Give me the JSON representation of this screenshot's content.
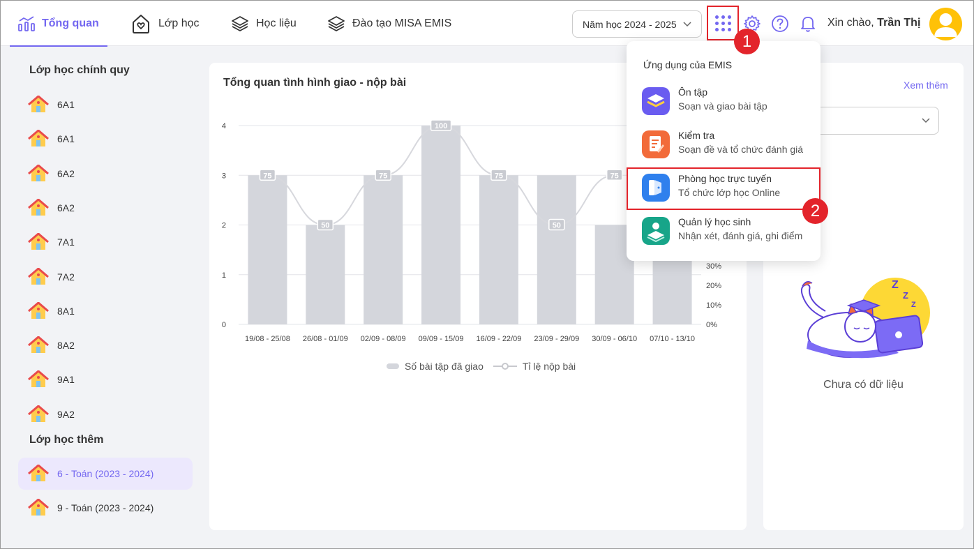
{
  "nav": {
    "overview": "Tổng quan",
    "classes": "Lớp học",
    "materials": "Học liệu",
    "training": "Đào tạo MISA EMIS"
  },
  "header": {
    "year": "Năm học 2024 - 2025",
    "greeting": "Xin chào,",
    "user": "Trần Thị"
  },
  "badges": {
    "one": "1",
    "two": "2"
  },
  "sidebar": {
    "regular_title": "Lớp học chính quy",
    "regular": [
      "6A1",
      "6A1",
      "6A2",
      "6A2",
      "7A1",
      "7A2",
      "8A1",
      "8A2",
      "9A1",
      "9A2"
    ],
    "extra_title": "Lớp học thêm",
    "extra": [
      "6 - Toán (2023 - 2024)",
      "9 - Toán (2023 - 2024)"
    ]
  },
  "chart_data": {
    "type": "bar",
    "title": "Tổng quan tình hình giao - nộp bài",
    "categories": [
      "19/08 - 25/08",
      "26/08 - 01/09",
      "02/09 - 08/09",
      "09/09 - 15/09",
      "16/09 - 22/09",
      "23/09 - 29/09",
      "30/09 - 06/10",
      "07/10 - 13/10"
    ],
    "series": [
      {
        "name": "Số bài tập đã giao",
        "type": "bar",
        "values": [
          3,
          2,
          3,
          4,
          3,
          3,
          2,
          2
        ]
      },
      {
        "name": "Tỉ lệ nộp bài",
        "type": "line",
        "values": [
          75,
          50,
          75,
          100,
          75,
          50,
          75,
          null
        ]
      }
    ],
    "y_left": {
      "ticks": [
        "0",
        "1",
        "2",
        "3",
        "4"
      ],
      "range": [
        0,
        4
      ]
    },
    "y_right": {
      "ticks": [
        "0%",
        "10%",
        "20%",
        "30%"
      ]
    },
    "grid": true,
    "legend": "bottom",
    "colors": {
      "bar": "#d4d6dc",
      "line": "#d7d8dd"
    }
  },
  "right_panel": {
    "title": "ch",
    "more": "Xem thêm",
    "empty": "Chưa có dữ liệu"
  },
  "apps_menu": {
    "title": "Ứng dụng của EMIS",
    "items": [
      {
        "name": "Ôn tập",
        "desc": "Soạn và giao bài tập",
        "color": "#6a5cf0",
        "icon": "book-stack-icon"
      },
      {
        "name": "Kiểm tra",
        "desc": "Soạn đề và tổ chức đánh giá",
        "color": "#f26b3a",
        "icon": "test-document-icon"
      },
      {
        "name": "Phòng học trực tuyến",
        "desc": "Tổ chức lớp học Online",
        "color": "#2f80ed",
        "icon": "online-classroom-icon"
      },
      {
        "name": "Quản lý học sinh",
        "desc": "Nhận xét, đánh giá, ghi điểm",
        "color": "#17a589",
        "icon": "student-management-icon"
      }
    ]
  }
}
